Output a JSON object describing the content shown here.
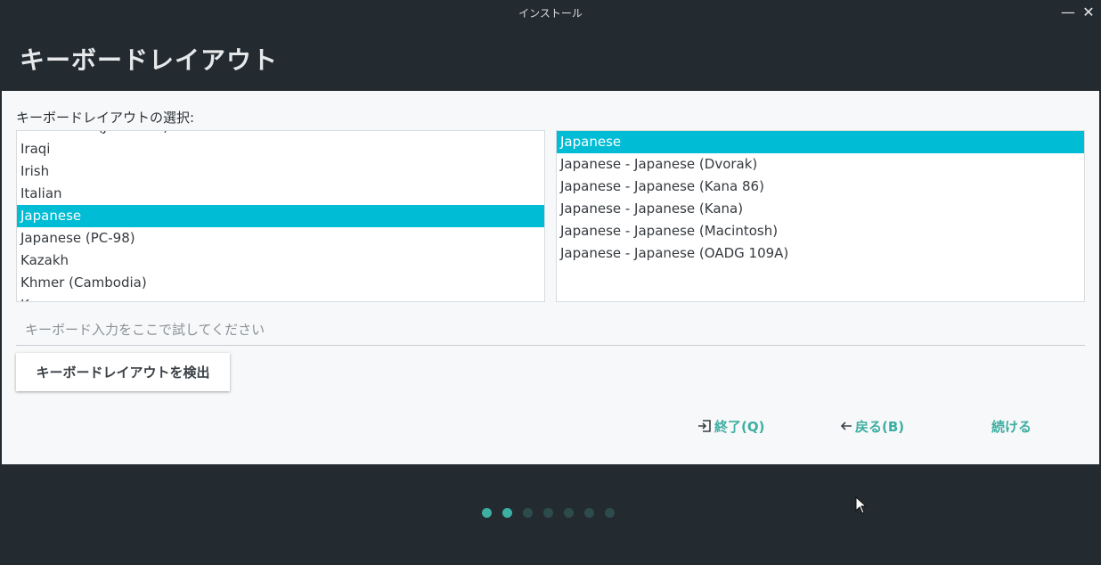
{
  "window": {
    "title": "インストール",
    "minimize_glyph": "—",
    "close_glyph": "✕"
  },
  "header": {
    "title": "キーボードレイアウト"
  },
  "layout_section": {
    "label": "キーボードレイアウトの選択:"
  },
  "layouts": {
    "items": [
      "Indonesian (Javanese)",
      "Iraqi",
      "Irish",
      "Italian",
      "Japanese",
      "Japanese (PC-98)",
      "Kazakh",
      "Khmer (Cambodia)",
      "Korean"
    ],
    "selected": "Japanese"
  },
  "variants": {
    "items": [
      "Japanese",
      "Japanese - Japanese (Dvorak)",
      "Japanese - Japanese (Kana 86)",
      "Japanese - Japanese (Kana)",
      "Japanese - Japanese (Macintosh)",
      "Japanese - Japanese (OADG 109A)"
    ],
    "selected": "Japanese"
  },
  "test_input": {
    "placeholder": "キーボード入力をここで試してください",
    "value": ""
  },
  "detect_button": {
    "label": "キーボードレイアウトを検出"
  },
  "nav": {
    "quit_label": "終了(Q)",
    "back_label": "戻る(B)",
    "continue_label": "続ける"
  },
  "progress": {
    "total_steps": 7,
    "completed_steps": 2
  },
  "colors": {
    "accent": "#00bcd4",
    "teal": "#3daea2",
    "background": "#232b31",
    "panel": "#f7f8f9"
  }
}
